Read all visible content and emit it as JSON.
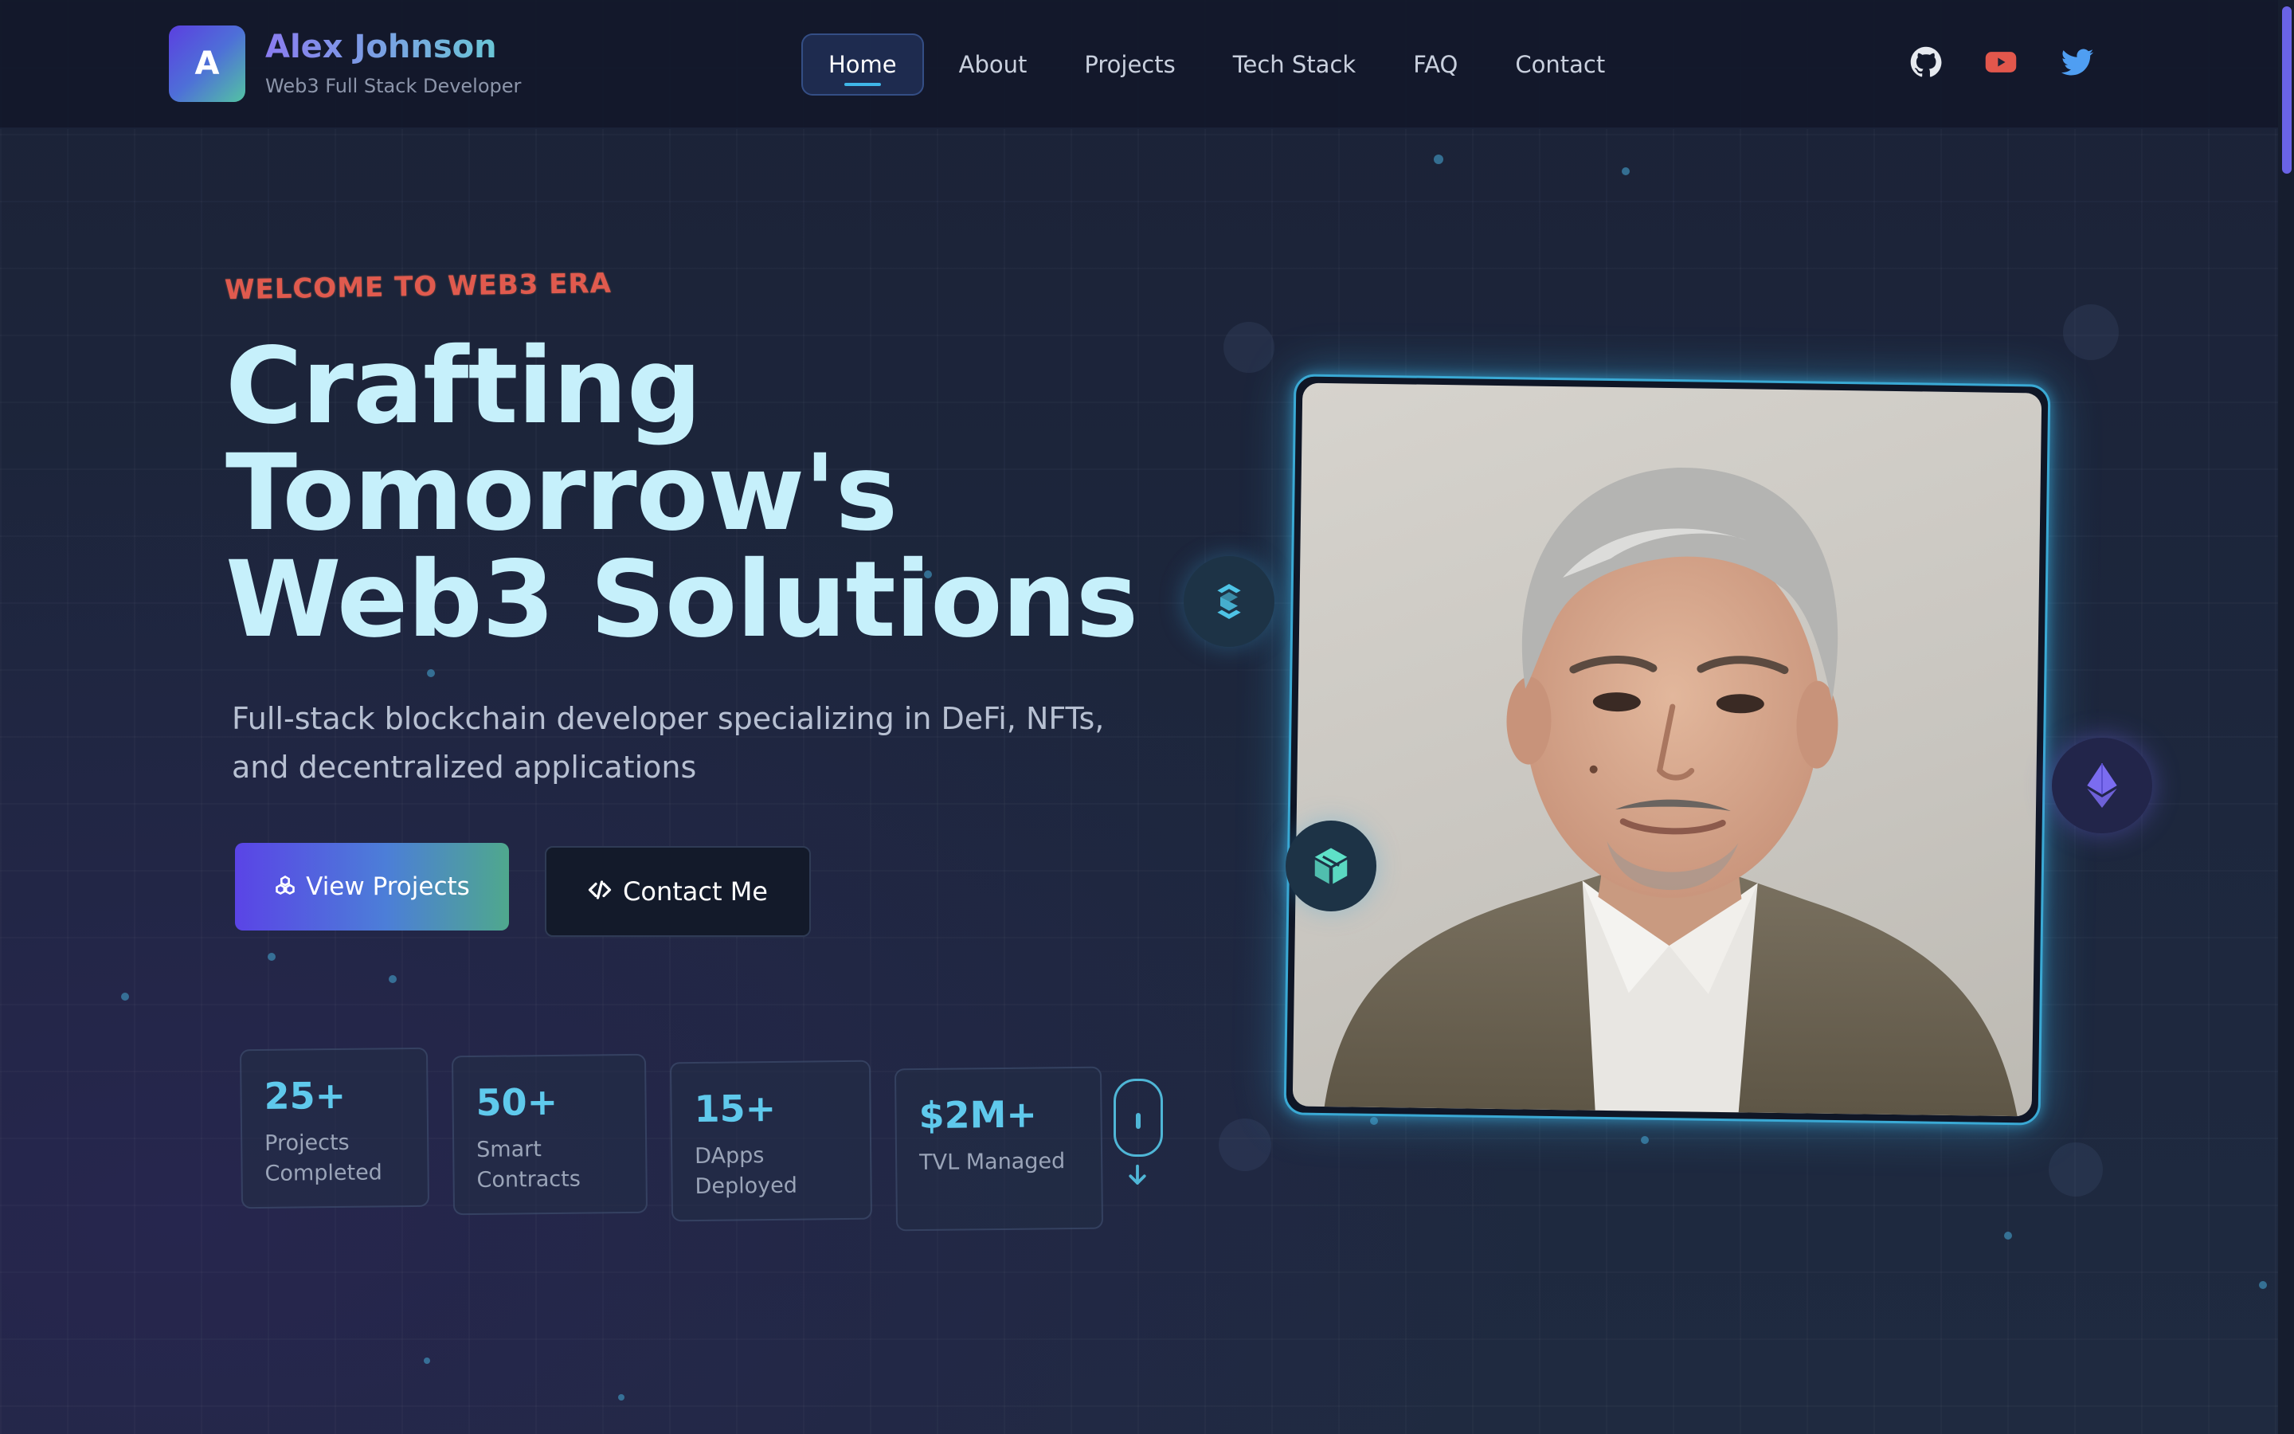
{
  "header": {
    "logo_letter": "A",
    "name": "Alex Johnson",
    "subtitle": "Web3 Full Stack Developer"
  },
  "nav": {
    "items": [
      {
        "label": "Home",
        "active": true
      },
      {
        "label": "About",
        "active": false
      },
      {
        "label": "Projects",
        "active": false
      },
      {
        "label": "Tech Stack",
        "active": false
      },
      {
        "label": "FAQ",
        "active": false
      },
      {
        "label": "Contact",
        "active": false
      }
    ]
  },
  "social": [
    {
      "icon": "github-icon",
      "color": "#e6e9ef"
    },
    {
      "icon": "youtube-icon",
      "color": "#e2574c"
    },
    {
      "icon": "twitter-icon",
      "color": "#4f9ef2"
    }
  ],
  "hero": {
    "eyebrow": "WELCOME TO WEB3 ERA",
    "title_line1": "Crafting",
    "title_line2": "Tomorrow's",
    "title_line3": "Web3 Solutions",
    "description": "Full-stack blockchain developer specializing in DeFi, NFTs, and decentralized applications",
    "primary_button": "View Projects",
    "secondary_button": "Contact Me"
  },
  "stats": [
    {
      "value": "25+",
      "label": "Projects Completed"
    },
    {
      "value": "50+",
      "label": "Smart Contracts"
    },
    {
      "value": "15+",
      "label": "DApps Deployed"
    },
    {
      "value": "$2M+",
      "label": "TVL Managed"
    }
  ],
  "floating_icons": [
    "chainlink-icon",
    "cube-icon",
    "ethereum-icon"
  ],
  "colors": {
    "accent": "#5fc9ec",
    "brand_gradient_start": "#5a44e6",
    "brand_gradient_end": "#4fa88d",
    "eyebrow": "#e05a4e"
  }
}
